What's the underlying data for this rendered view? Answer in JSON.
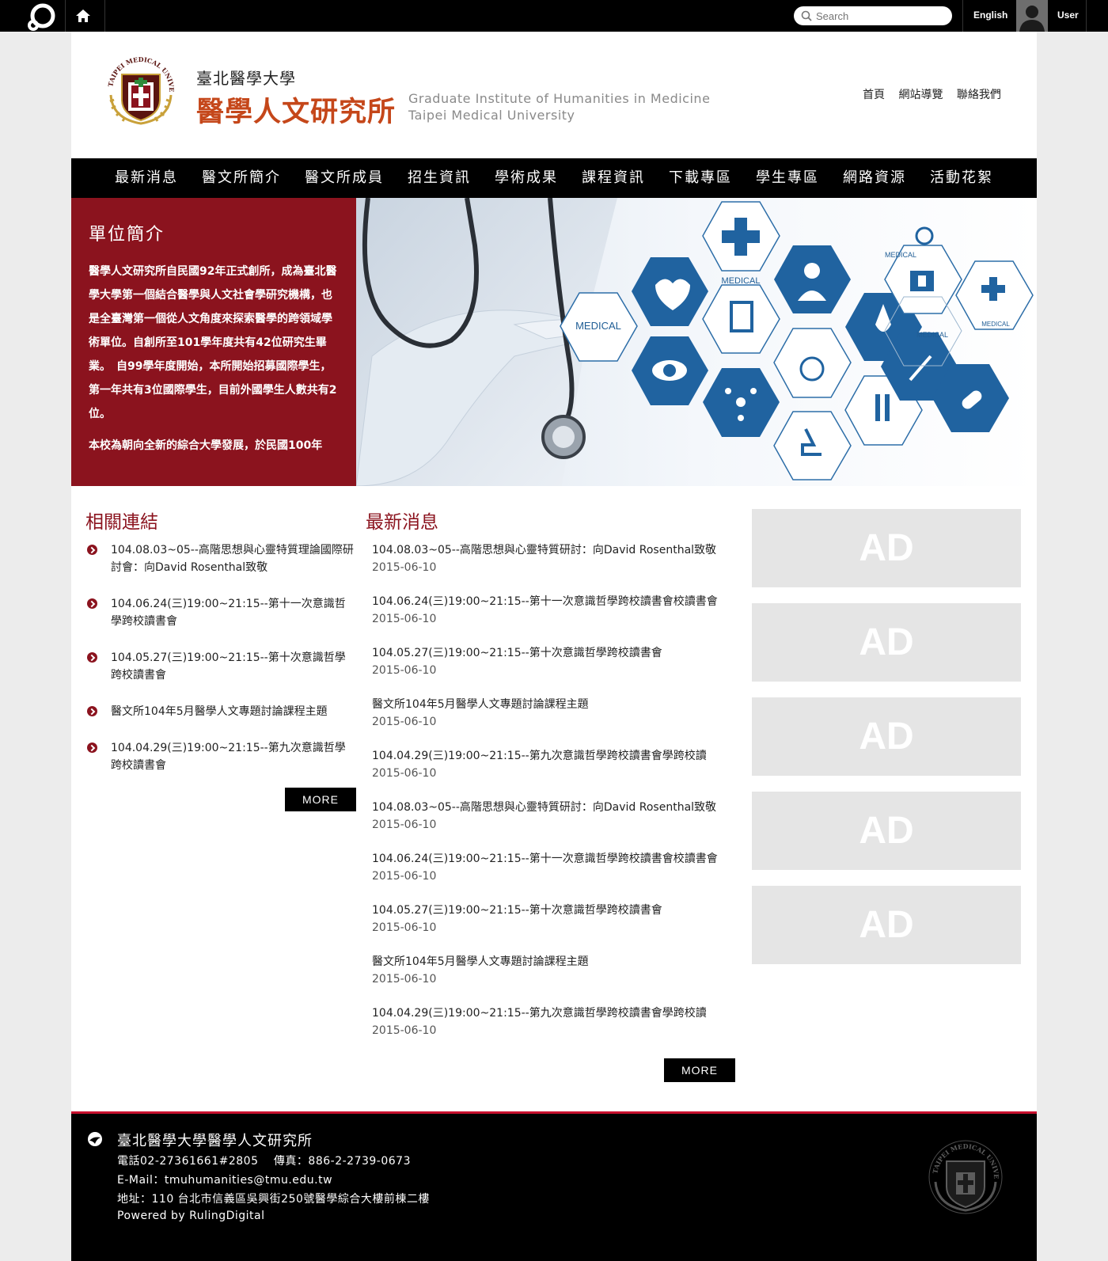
{
  "topbar": {
    "logo_icon": "platform-logo-icon",
    "home_icon": "home-icon",
    "search_placeholder": "Search",
    "language": "English",
    "user_label": "User"
  },
  "header": {
    "university": "臺北醫學大學",
    "institute": "醫學人文研究所",
    "english_line1": "Graduate Institute of Humanities in Medicine",
    "english_line2": "Taipei Medical University",
    "seal_icon": "tmu-seal-logo",
    "util_links": [
      "首頁",
      "網站導覽",
      "聯絡我們"
    ]
  },
  "nav": [
    "最新消息",
    "醫文所簡介",
    "醫文所成員",
    "招生資訊",
    "學術成果",
    "課程資訊",
    "下載專區",
    "學生專區",
    "網路資源",
    "活動花絮"
  ],
  "intro": {
    "title": "單位簡介",
    "paragraph1": "醫學人文研究所自民國92年正式創所，成為臺北醫學大學第一個結合醫學與人文社會學研究機構，也是全臺灣第一個從人文角度來探索醫學的跨領域學術單位。自創所至101學年度共有42位研究生畢業。　自99學年度開始，本所開始招募國際學生，第一年共有3位國際學生，目前外國學生人數共有2位。",
    "paragraph2": "本校為朝向全新的綜合大學發展，於民國100年"
  },
  "links": {
    "title": "相關連結",
    "items": [
      "104.08.03~05--高階思想與心靈特質理論國際研討會：向David Rosenthal致敬",
      "104.06.24(三)19:00~21:15--第十一次意識哲學跨校讀書會",
      "104.05.27(三)19:00~21:15--第十次意識哲學跨校讀書會",
      "醫文所104年5月醫學人文專題討論課程主題",
      "104.04.29(三)19:00~21:15--第九次意識哲學跨校讀書會"
    ],
    "more": "MORE"
  },
  "news": {
    "title": "最新消息",
    "items": [
      {
        "title": "104.08.03~05--高階思想與心靈特質研討：向David Rosenthal致敬",
        "date": "2015-06-10"
      },
      {
        "title": "104.06.24(三)19:00~21:15--第十一次意識哲學跨校讀書會校讀書會",
        "date": "2015-06-10"
      },
      {
        "title": "104.05.27(三)19:00~21:15--第十次意識哲學跨校讀書會",
        "date": "2015-06-10"
      },
      {
        "title": "醫文所104年5月醫學人文專題討論課程主題",
        "date": "2015-06-10"
      },
      {
        "title": "104.04.29(三)19:00~21:15--第九次意識哲學跨校讀書會學跨校讀",
        "date": "2015-06-10"
      },
      {
        "title": "104.08.03~05--高階思想與心靈特質研討：向David Rosenthal致敬",
        "date": "2015-06-10"
      },
      {
        "title": "104.06.24(三)19:00~21:15--第十一次意識哲學跨校讀書會校讀書會",
        "date": "2015-06-10"
      },
      {
        "title": "104.05.27(三)19:00~21:15--第十次意識哲學跨校讀書會",
        "date": "2015-06-10"
      },
      {
        "title": "醫文所104年5月醫學人文專題討論課程主題",
        "date": "2015-06-10"
      },
      {
        "title": "104.04.29(三)19:00~21:15--第九次意識哲學跨校讀書會學跨校讀",
        "date": "2015-06-10"
      }
    ],
    "more": "MORE"
  },
  "ads": [
    "AD",
    "AD",
    "AD",
    "AD",
    "AD"
  ],
  "footer": {
    "name": "臺北醫學大學醫學人文研究所",
    "phone": "電話02-27361661#2805　 傳真：886-2-2739-0673",
    "email": "E-Mail：tmuhumanities@tmu.edu.tw",
    "address": "地址：110 台北市信義區吳興街250號醫學綜合大樓前棟二樓",
    "powered": "Powered by RulingDigital"
  },
  "colors": {
    "brand_red": "#8b131e",
    "institute_orange": "#c5471a",
    "footer_accent": "#c8102e",
    "nav_bg": "#000000"
  }
}
